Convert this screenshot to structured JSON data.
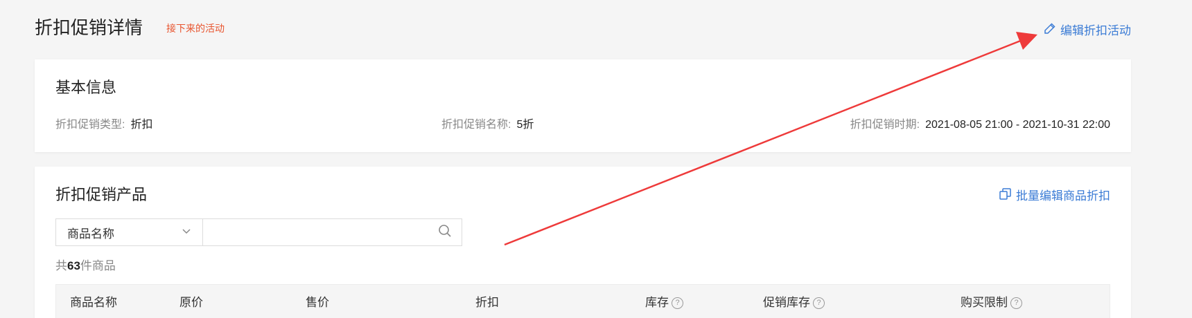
{
  "header": {
    "title": "折扣促销详情",
    "status_tag": "接下来的活动",
    "edit_label": "编辑折扣活动"
  },
  "basic_info": {
    "title": "基本信息",
    "type_label": "折扣促销类型:",
    "type_value": "折扣",
    "name_label": "折扣促销名称:",
    "name_value": "5折",
    "time_label": "折扣促销时期:",
    "time_value": "2021-08-05 21:00 - 2021-10-31 22:00"
  },
  "products": {
    "title": "折扣促销产品",
    "bulk_edit_label": "批量编辑商品折扣",
    "search": {
      "selected_field": "商品名称",
      "input_value": "",
      "placeholder": ""
    },
    "count_prefix": "共",
    "count_value": "63",
    "count_suffix": "件商品",
    "columns": [
      "商品名称",
      "原价",
      "售价",
      "折扣",
      "库存",
      "促销库存",
      "购买限制"
    ],
    "help_glyph": "?"
  },
  "icons": {
    "edit": "pencil-icon",
    "bulk_edit": "copy-icon",
    "dropdown": "chevron-down-icon",
    "search": "search-icon",
    "help": "help-circle-icon"
  },
  "colors": {
    "link": "#3a7bd5",
    "status_tag": "#e8542e",
    "annotation_arrow": "#ee3a3a"
  }
}
